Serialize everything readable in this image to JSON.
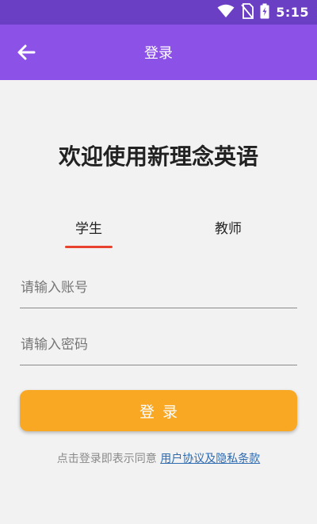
{
  "status_bar": {
    "time": "5:15",
    "icons": [
      "wifi-icon",
      "no-sim-icon",
      "battery-charging-icon"
    ]
  },
  "toolbar": {
    "back_icon": "arrow-left-icon",
    "title": "登录"
  },
  "welcome_title": "欢迎使用新理念英语",
  "tabs": [
    {
      "label": "学生",
      "selected": true
    },
    {
      "label": "教师",
      "selected": false
    }
  ],
  "form": {
    "account_placeholder": "请输入账号",
    "account_value": "",
    "password_placeholder": "请输入密码",
    "password_value": ""
  },
  "login_label": "登录",
  "agreement": {
    "prefix": "点击登录即表示同意",
    "link": "用户协议及隐私条款"
  },
  "colors": {
    "status_bar": "#6b3fc4",
    "toolbar": "#8c52e8",
    "background": "#f2f2f2",
    "tab_indicator": "#e8432e",
    "login_button": "#f9a823",
    "link": "#2f6bb0"
  }
}
